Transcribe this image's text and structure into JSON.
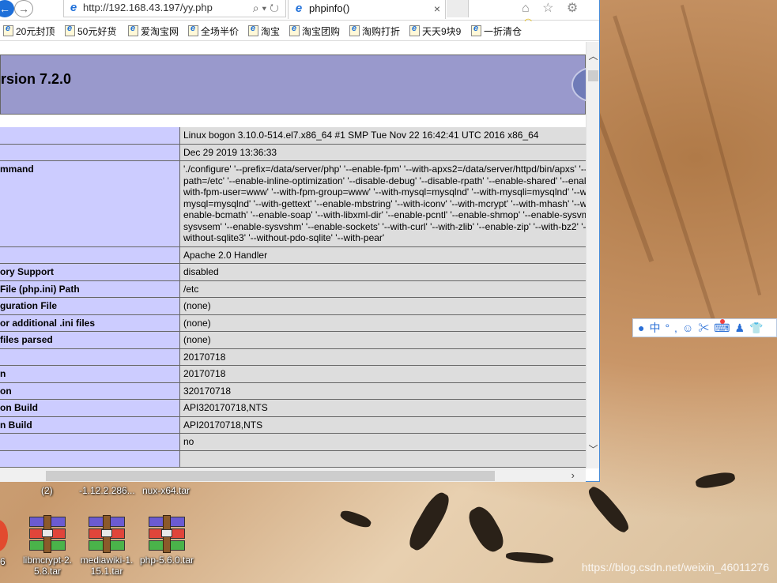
{
  "browser": {
    "url": "http://192.168.43.197/yy.php",
    "tab_title": "phpinfo()",
    "tab_close": "×",
    "nav_back": "←",
    "nav_forward": "→",
    "url_tools": "⌕ ▾ ↻",
    "toolbar_icons": "⌂ ☆ ⚙",
    "smiley": "☺"
  },
  "favorites": [
    "20元封顶",
    "50元好货",
    "爱淘宝网",
    "全场半价",
    "淘宝",
    "淘宝团购",
    "淘购打折",
    "天天9块9",
    "一折清仓"
  ],
  "phpinfo": {
    "title": "rsion 7.2.0",
    "rows": [
      {
        "key": "",
        "value": "Linux bogon 3.10.0-514.el7.x86_64 #1 SMP Tue Nov 22 16:42:41 UTC 2016 x86_64"
      },
      {
        "key": "",
        "value": "Dec 29 2019 13:36:33"
      },
      {
        "key": "mmand",
        "value": "'./configure' '--prefix=/data/server/php' '--enable-fpm' '--with-apxs2=/data/server/httpd/bin/apxs' '--\npath=/etc' '--enable-inline-optimization' '--disable-debug' '--disable-rpath' '--enable-shared' '--enal\nwith-fpm-user=www' '--with-fpm-group=www' '--with-mysql=mysqlnd' '--with-mysqli=mysqlnd' '--w\nmysql=mysqlnd' '--with-gettext' '--enable-mbstring' '--with-iconv' '--with-mcrypt' '--with-mhash' '--w\nenable-bcmath' '--enable-soap' '--with-libxml-dir' '--enable-pcntl' '--enable-shmop' '--enable-sysvm\nsysvsem' '--enable-sysvshm' '--enable-sockets' '--with-curl' '--with-zlib' '--enable-zip' '--with-bz2' '-\nwithout-sqlite3' '--without-pdo-sqlite' '--with-pear'"
      },
      {
        "key": "",
        "value": "Apache 2.0 Handler"
      },
      {
        "key": "ory Support",
        "value": "disabled"
      },
      {
        "key": " File (php.ini) Path",
        "value": "/etc"
      },
      {
        "key": "guration File",
        "value": "(none)"
      },
      {
        "key": "or additional .ini files",
        "value": "(none)"
      },
      {
        "key": " files parsed",
        "value": "(none)"
      },
      {
        "key": "",
        "value": "20170718"
      },
      {
        "key": "n",
        "value": "20170718"
      },
      {
        "key": "on",
        "value": "320170718"
      },
      {
        "key": "on Build",
        "value": "API320170718,NTS"
      },
      {
        "key": "n Build",
        "value": "API20170718,NTS"
      },
      {
        "key": "",
        "value": "no"
      },
      {
        "key": "",
        "value": ""
      }
    ]
  },
  "scroll": {
    "up": "︿",
    "down": "﹀",
    "right": "›"
  },
  "desktop": {
    "top_labels": [
      "(2)",
      "-1.12.2.286...",
      "nux-x64.tar"
    ],
    "left_partial": "6",
    "icons": [
      {
        "label": "libmcrypt-2.\n5.8.tar"
      },
      {
        "label": "mediawiki-1.\n15.1.tar"
      },
      {
        "label": "php-5.6.0.tar"
      }
    ],
    "watermark": "https://blog.csdn.net/weixin_46011276"
  },
  "ime": {
    "text": "●中°,☺✂⌨♟👕"
  }
}
